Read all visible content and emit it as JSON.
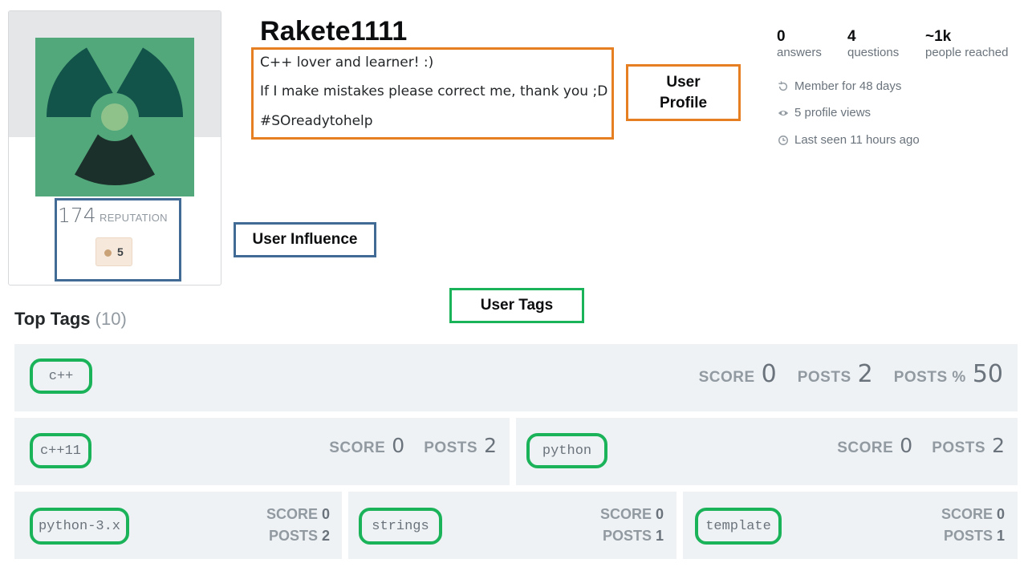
{
  "profile": {
    "username": "Rakete1111",
    "reputation": "174",
    "reputation_label": "REPUTATION",
    "bronze_badges": "5",
    "bio": [
      "C++ lover and learner! :)",
      "If I make mistakes please correct me, thank you ;D",
      "#SOreadytohelp"
    ]
  },
  "annotations": {
    "profile": "User Profile",
    "influence": "User Influence",
    "tags": "User Tags"
  },
  "stats": [
    {
      "value": "0",
      "label": "answers"
    },
    {
      "value": "4",
      "label": "questions"
    },
    {
      "value": "~1k",
      "label": "people reached"
    }
  ],
  "meta": {
    "member": "Member for 48 days",
    "views": "5 profile views",
    "last_seen": "Last seen 11 hours ago"
  },
  "top_tags": {
    "title": "Top Tags",
    "count": "(10)",
    "score_label": "SCORE",
    "posts_label": "POSTS",
    "posts_pct_label": "POSTS %",
    "items": [
      {
        "name": "c++",
        "score": "0",
        "posts": "2",
        "posts_pct": "50"
      },
      {
        "name": "c++11",
        "score": "0",
        "posts": "2"
      },
      {
        "name": "python",
        "score": "0",
        "posts": "2"
      },
      {
        "name": "python-3.x",
        "score": "0",
        "posts": "2"
      },
      {
        "name": "strings",
        "score": "0",
        "posts": "1"
      },
      {
        "name": "template",
        "score": "0",
        "posts": "1"
      }
    ]
  },
  "colors": {
    "avatar_bg": "#52a77b",
    "avatar_blade": "#12544a",
    "avatar_center": "#8fc28b",
    "profile_annot": "#e67e22",
    "influence_annot": "#416a94",
    "tags_annot": "#1bb35a"
  },
  "icons": {
    "member": "history-icon",
    "views": "eye-icon",
    "last_seen": "clock-icon"
  }
}
